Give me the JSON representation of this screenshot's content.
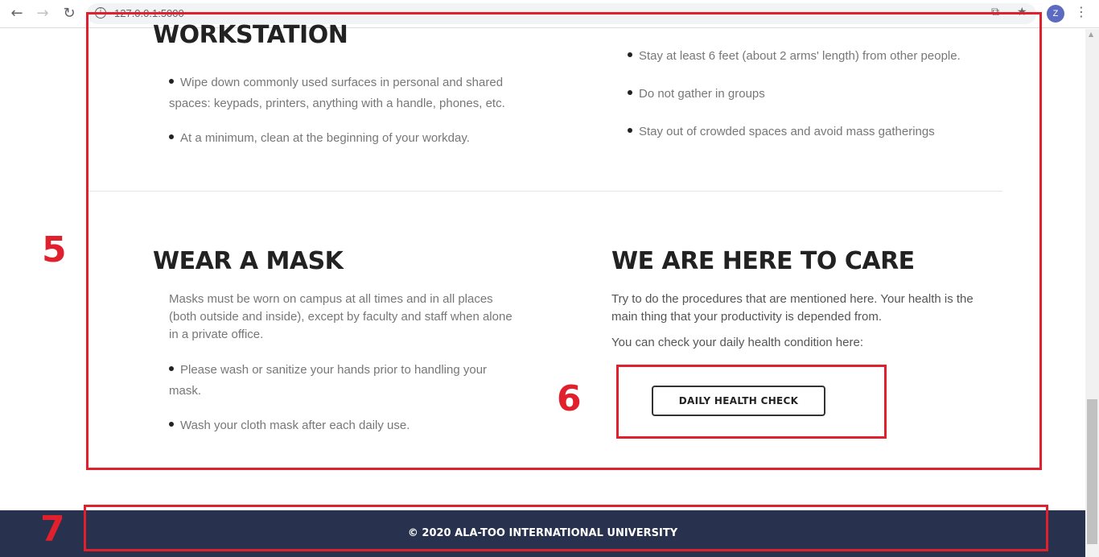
{
  "browser": {
    "url": "127.0.0.1:5000",
    "avatar_letter": "Z",
    "back_icon": "←",
    "forward_icon": "→",
    "reload_icon": "↻",
    "info_icon": "i",
    "translate_icon": "⧉",
    "star_icon": "★",
    "menu_icon": "⋮"
  },
  "workstation": {
    "title": "WORKSTATION",
    "bullets": [
      "Wipe down commonly used surfaces in personal and shared spaces: keypads, printers, anything with a handle, phones, etc.",
      "At a minimum, clean at the beginning of your workday."
    ]
  },
  "distance": {
    "bullets": [
      "Stay at least 6 feet (about 2 arms' length) from other people.",
      "Do not gather in groups",
      "Stay out of crowded spaces and avoid mass gatherings"
    ]
  },
  "mask": {
    "title": "WEAR A MASK",
    "intro": "Masks must be worn on campus at all times and in all places (both outside and inside), except by faculty and staff when alone in a private office.",
    "bullets": [
      "Please wash or sanitize your hands prior to handling your mask.",
      "Wash your cloth mask after each daily use."
    ]
  },
  "care": {
    "title": "WE ARE HERE TO CARE",
    "text1": "Try to do the procedures that are mentioned here. Your health is the main thing that your productivity is depended from.",
    "text2": "You can check your daily health condition here:",
    "button_label": "DAILY HEALTH CHECK"
  },
  "footer": {
    "copyright": "© 2020 ALA-TOO INTERNATIONAL UNIVERSITY"
  },
  "annotations": {
    "label_5": "5",
    "label_6": "6",
    "label_7": "7",
    "color": "#e0202c"
  },
  "colors": {
    "footer_bg": "#28324e",
    "text_gray": "#777777",
    "heading": "#222222"
  }
}
